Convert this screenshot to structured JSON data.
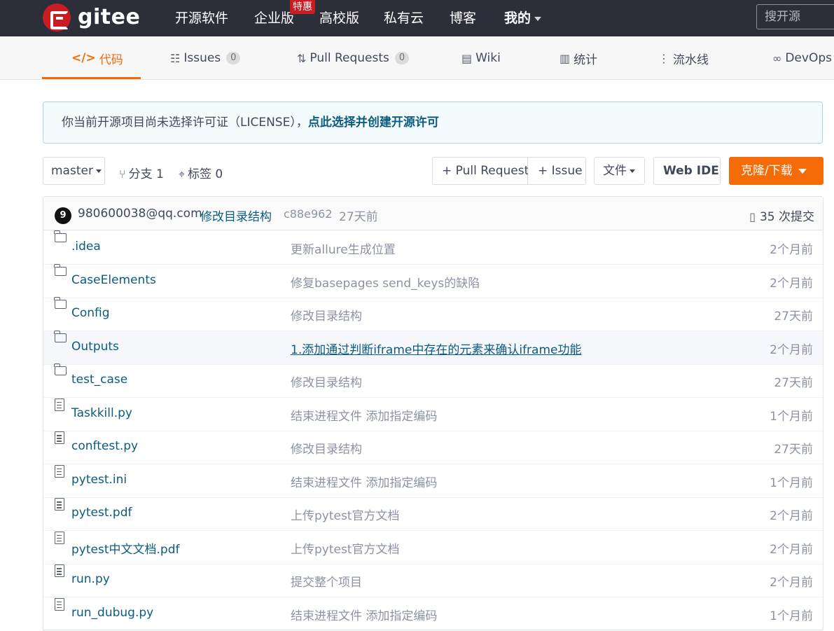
{
  "header": {
    "logo_text": "gitee",
    "nav": [
      "开源软件",
      "企业版",
      "高校版",
      "私有云",
      "博客",
      "我的"
    ],
    "hot_badge": "特惠",
    "search_placeholder": "搜开源"
  },
  "tabs": [
    {
      "label": "代码",
      "icon": "code-icon"
    },
    {
      "label": "Issues",
      "count": "0",
      "icon": "issues-icon"
    },
    {
      "label": "Pull Requests",
      "count": "0",
      "icon": "pull-request-icon"
    },
    {
      "label": "Wiki",
      "icon": "wiki-icon"
    },
    {
      "label": "统计",
      "icon": "stats-icon"
    },
    {
      "label": "流水线",
      "icon": "pipeline-icon"
    },
    {
      "label": "DevOps",
      "icon": "devops-icon"
    }
  ],
  "notice": {
    "text": "你当前开源项目尚未选择许可证（LICENSE），",
    "link": "点此选择并创建开源许可"
  },
  "controls": {
    "branch": "master",
    "branches": "分支 1",
    "tags": "标签 0",
    "pull_request": "+ Pull Request",
    "issue": "+ Issue",
    "file": "文件",
    "web_ide": "Web IDE",
    "clone": "克隆/下载"
  },
  "commit": {
    "avatar": "9",
    "author": "980600038@qq.com",
    "message": "修改目录结构",
    "hash": "c88e962",
    "time": "27天前",
    "commits": "35 次提交"
  },
  "files": [
    {
      "type": "folder",
      "name": ".idea",
      "message": "更新allure生成位置",
      "time": "2个月前"
    },
    {
      "type": "folder",
      "name": "CaseElements",
      "message": "修复basepages send_keys的缺陷",
      "time": "2个月前"
    },
    {
      "type": "folder",
      "name": "Config",
      "message": "修改目录结构",
      "time": "27天前"
    },
    {
      "type": "folder",
      "name": "Outputs",
      "message": "1.添加通过判断iframe中存在的元素来确认iframe功能",
      "time": "2个月前"
    },
    {
      "type": "folder",
      "name": "test_case",
      "message": "修改目录结构",
      "time": "27天前"
    },
    {
      "type": "file",
      "name": "Taskkill.py",
      "message": "结束进程文件 添加指定编码",
      "time": "1个月前"
    },
    {
      "type": "file",
      "name": "conftest.py",
      "message": "修改目录结构",
      "time": "27天前"
    },
    {
      "type": "file",
      "name": "pytest.ini",
      "message": "结束进程文件 添加指定编码",
      "time": "1个月前"
    },
    {
      "type": "file",
      "name": "pytest.pdf",
      "message": "上传pytest官方文档",
      "time": "2个月前"
    },
    {
      "type": "file",
      "name": "pytest中文文档.pdf",
      "message": "上传pytest官方文档",
      "time": "2个月前"
    },
    {
      "type": "file",
      "name": "run.py",
      "message": "提交整个项目",
      "time": "2个月前"
    },
    {
      "type": "file",
      "name": "run_dubug.py",
      "message": "结束进程文件 添加指定编码",
      "time": "1个月前"
    }
  ]
}
